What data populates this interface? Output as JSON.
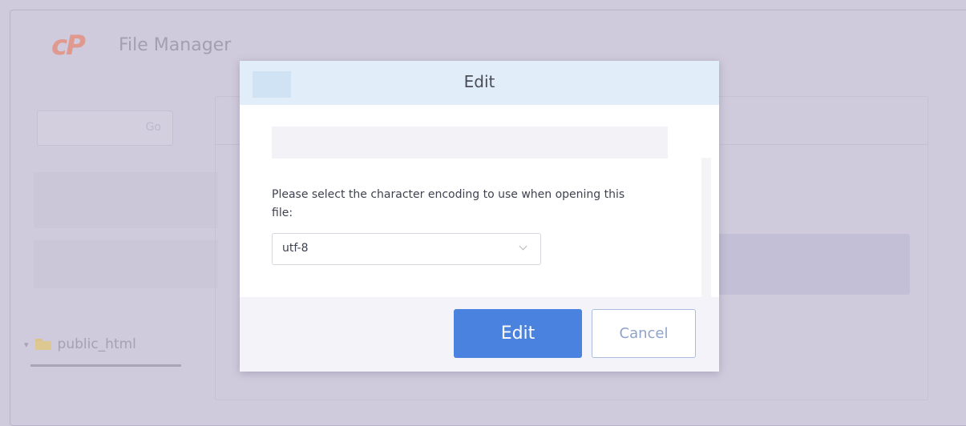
{
  "app": {
    "logo_text": "cP",
    "title": "File Manager"
  },
  "search": {
    "go_label": "Go"
  },
  "tree": {
    "items": [
      {
        "label": "public_html",
        "toggle": "▾"
      }
    ]
  },
  "dialog": {
    "title": "Edit",
    "prompt": "Please select the character encoding to use when opening this file:",
    "encoding": {
      "selected": "utf-8"
    },
    "buttons": {
      "edit": "Edit",
      "cancel": "Cancel"
    }
  },
  "colors": {
    "overlay": "#cfcbdc",
    "header": "#e1eefa",
    "primary_button": "#4a82e0",
    "cancel_text": "#8fa3c9",
    "logo": "#e0998f"
  },
  "icons": [
    "folder-icon",
    "chevron-down-icon",
    "tree-toggle-icon"
  ]
}
